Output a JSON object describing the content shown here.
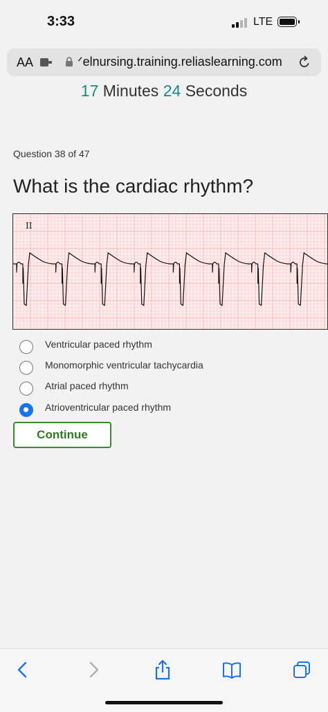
{
  "status": {
    "time": "3:33",
    "network": "LTE"
  },
  "browser": {
    "aa_label": "AA",
    "url": "ᐟelnursing.training.reliaslearning.com"
  },
  "timer": {
    "minutes": "17",
    "minutes_label": "Minutes",
    "seconds": "24",
    "seconds_label": "Seconds"
  },
  "question": {
    "counter": "Question 38 of 47",
    "text": "What is the cardiac rhythm?",
    "strip_lead": "II"
  },
  "options": [
    {
      "label": "Ventricular paced rhythm",
      "selected": false
    },
    {
      "label": "Monomorphic ventricular tachycardia",
      "selected": false
    },
    {
      "label": "Atrial paced rhythm",
      "selected": false
    },
    {
      "label": "Atrioventricular paced rhythm",
      "selected": true
    }
  ],
  "continue_label": "Continue",
  "colors": {
    "accent": "#1a8a8a",
    "radio_selected": "#1a73e8",
    "continue_border": "#3b8a2f",
    "ecg_grid": "#f4b8b8"
  },
  "toolbar_icons": [
    "back-icon",
    "forward-icon",
    "share-icon",
    "bookmarks-icon",
    "tabs-icon"
  ]
}
